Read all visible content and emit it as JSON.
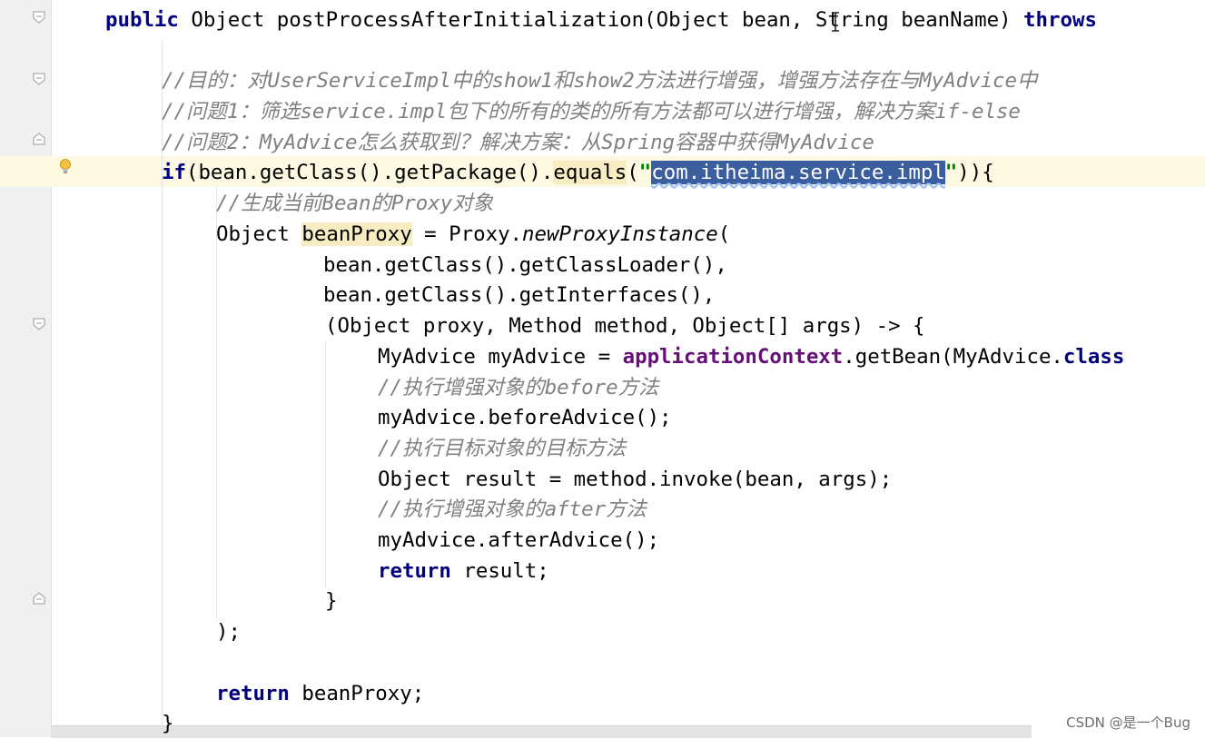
{
  "editor": {
    "lines": [
      {
        "id": "l1",
        "segments": [
          {
            "t": "public",
            "c": "kw"
          },
          {
            "t": " Object postProcessAfterInitialization(Object bean, String beanName) "
          },
          {
            "t": "throws",
            "c": "kw"
          }
        ]
      },
      {
        "id": "l2",
        "segments": []
      },
      {
        "id": "l3",
        "segments": [
          {
            "t": "//目的：对UserServiceImpl中的show1和show2方法进行增强，增强方法存在与MyAdvice中",
            "c": "cm"
          }
        ]
      },
      {
        "id": "l4",
        "segments": [
          {
            "t": "//问题1：筛选service.impl包下的所有的类的所有方法都可以进行增强，解决方案if-else",
            "c": "cm"
          }
        ]
      },
      {
        "id": "l5",
        "segments": [
          {
            "t": "//问题2：MyAdvice怎么获取到？解决方案：从Spring容器中获得MyAdvice",
            "c": "cm"
          }
        ]
      },
      {
        "id": "l6",
        "segments": [
          {
            "t": "if",
            "c": "kw"
          },
          {
            "t": "(bean.getClass().getPackage()."
          },
          {
            "t": "equals",
            "c": "mark"
          },
          {
            "t": "("
          },
          {
            "t": "\"",
            "c": "st"
          },
          {
            "t": "com.itheima.service.impl",
            "c": "sel"
          },
          {
            "t": "\"",
            "c": "st"
          },
          {
            "t": ")){"
          }
        ]
      },
      {
        "id": "l7",
        "segments": [
          {
            "t": "//生成当前Bean的Proxy对象",
            "c": "cm"
          }
        ]
      },
      {
        "id": "l8",
        "segments": [
          {
            "t": "Object "
          },
          {
            "t": "beanProxy",
            "c": "mark"
          },
          {
            "t": " = Proxy."
          },
          {
            "t": "newProxyInstance",
            "c": "fn"
          },
          {
            "t": "("
          }
        ]
      },
      {
        "id": "l9",
        "segments": [
          {
            "t": "bean.getClass().getClassLoader(),"
          }
        ]
      },
      {
        "id": "l10",
        "segments": [
          {
            "t": "bean.getClass().getInterfaces(),"
          }
        ]
      },
      {
        "id": "l11",
        "segments": [
          {
            "t": "(Object proxy, Method method, Object[] args) -> {"
          }
        ]
      },
      {
        "id": "l12",
        "segments": [
          {
            "t": "MyAdvice myAdvice = "
          },
          {
            "t": "applicationContext",
            "c": "fd"
          },
          {
            "t": ".getBean(MyAdvice."
          },
          {
            "t": "class",
            "c": "kw"
          }
        ]
      },
      {
        "id": "l13",
        "segments": [
          {
            "t": "//执行增强对象的before方法",
            "c": "cm"
          }
        ]
      },
      {
        "id": "l14",
        "segments": [
          {
            "t": "myAdvice.beforeAdvice();"
          }
        ]
      },
      {
        "id": "l15",
        "segments": [
          {
            "t": "//执行目标对象的目标方法",
            "c": "cm"
          }
        ]
      },
      {
        "id": "l16",
        "segments": [
          {
            "t": "Object result = method.invoke(bean, args);"
          }
        ]
      },
      {
        "id": "l17",
        "segments": [
          {
            "t": "//执行增强对象的after方法",
            "c": "cm"
          }
        ]
      },
      {
        "id": "l18",
        "segments": [
          {
            "t": "myAdvice.afterAdvice();"
          }
        ]
      },
      {
        "id": "l19",
        "segments": [
          {
            "t": "return",
            "c": "kw"
          },
          {
            "t": " result;"
          }
        ]
      },
      {
        "id": "l20",
        "segments": [
          {
            "t": "}"
          }
        ]
      },
      {
        "id": "l21",
        "segments": [
          {
            "t": ");"
          }
        ]
      },
      {
        "id": "l22",
        "segments": []
      },
      {
        "id": "l23",
        "segments": [
          {
            "t": "return",
            "c": "kw"
          },
          {
            "t": " beanProxy;"
          }
        ]
      },
      {
        "id": "l24",
        "segments": [
          {
            "t": "}"
          }
        ]
      }
    ]
  },
  "watermark": "CSDN @是一个Bug",
  "icons": {
    "gutter_bulb": "lightbulb-icon",
    "fold": "fold-marker-icon"
  }
}
